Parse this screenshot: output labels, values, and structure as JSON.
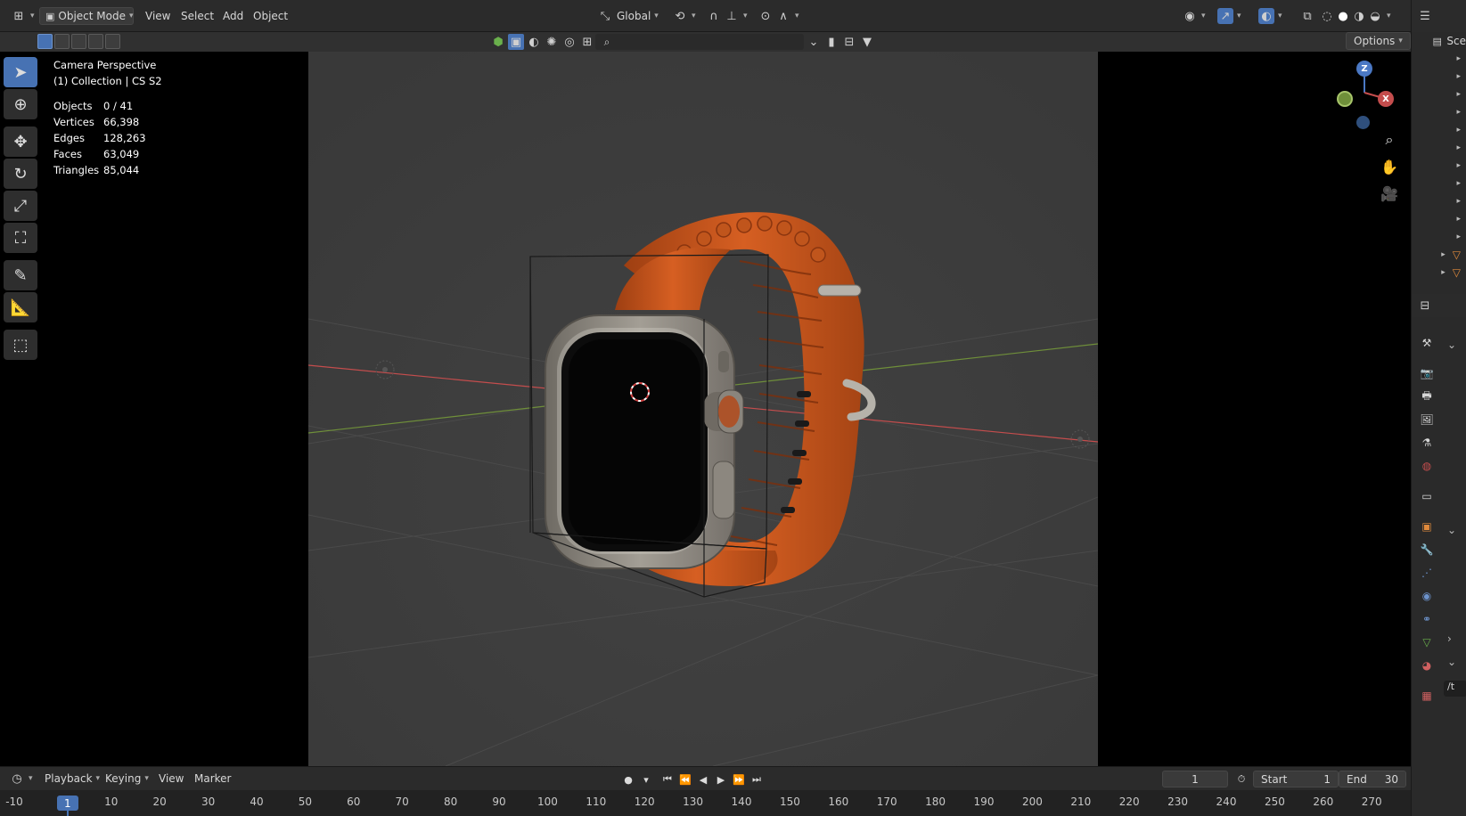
{
  "header": {
    "mode": "Object Mode",
    "menus": [
      "View",
      "Select",
      "Add",
      "Object"
    ],
    "transform_orientation": "Global",
    "options_label": "Options"
  },
  "viewport": {
    "view_name": "Camera Perspective",
    "collection": "(1) Collection | CS S2",
    "stats": [
      {
        "label": "Objects",
        "value": "0 / 41"
      },
      {
        "label": "Vertices",
        "value": "66,398"
      },
      {
        "label": "Edges",
        "value": "128,263"
      },
      {
        "label": "Faces",
        "value": "63,049"
      },
      {
        "label": "Triangles",
        "value": "85,044"
      }
    ],
    "gizmo": {
      "z": "Z",
      "x": "X"
    }
  },
  "tools": [
    "select-box-icon",
    "cursor-icon",
    "move-icon",
    "rotate-icon",
    "scale-icon",
    "transform-icon",
    "annotate-icon",
    "measure-icon",
    "add-cube-icon"
  ],
  "outliner": {
    "label": "Sce"
  },
  "properties": {
    "path_label": "/t"
  },
  "timeline": {
    "menus": [
      "Playback",
      "Keying",
      "View",
      "Marker"
    ],
    "current_frame": "1",
    "start_label": "Start",
    "start_value": "1",
    "end_label": "End",
    "end_value": "30",
    "ruler": [
      "-10",
      "1",
      "10",
      "20",
      "30",
      "40",
      "50",
      "60",
      "70",
      "80",
      "90",
      "100",
      "110",
      "120",
      "130",
      "140",
      "150",
      "160",
      "170",
      "180",
      "190",
      "200",
      "210",
      "220",
      "230",
      "240",
      "250",
      "260",
      "270"
    ]
  },
  "colors": {
    "accent": "#4772b3",
    "band": "#c8531c",
    "case": "#8f8a82",
    "axis_x": "#c44d4d",
    "axis_y": "#6f8f3a"
  }
}
